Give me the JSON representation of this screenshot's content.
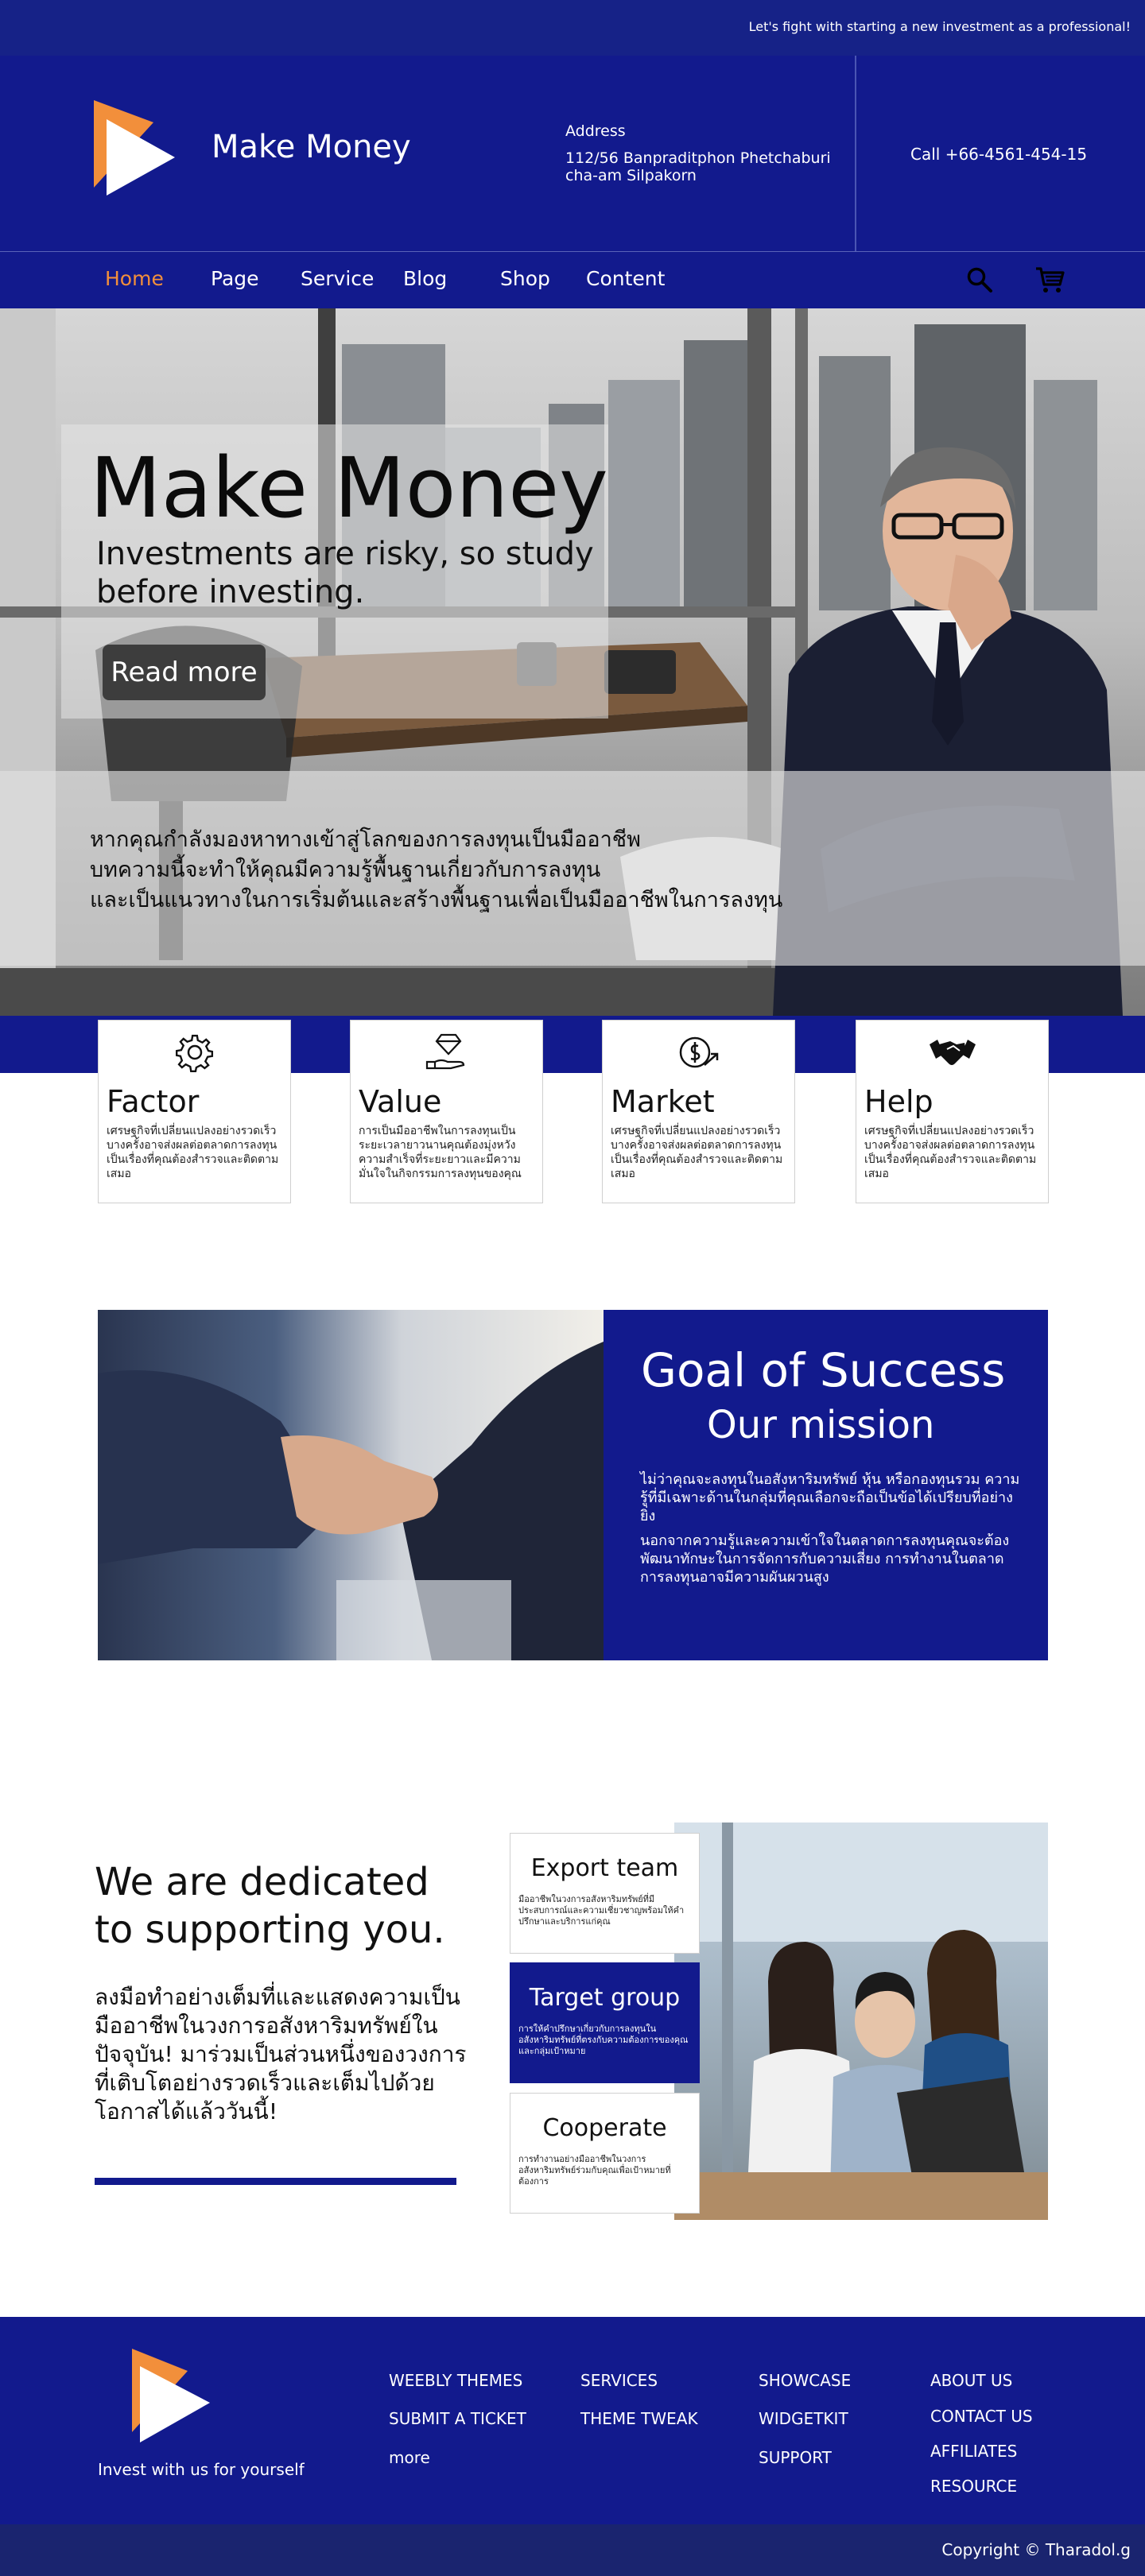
{
  "topbar": {
    "tagline": "Let's fight with starting a new investment as a professional!"
  },
  "header": {
    "brand": "Make Money",
    "address_title": "Address",
    "address_line1": "112/56 Banpraditphon Phetchaburi",
    "address_line2": "cha-am  Silpakorn",
    "call": "Call +66-4561-454-15"
  },
  "nav": {
    "items": [
      "Home",
      "Page",
      "Service",
      "Blog",
      "Shop",
      "Content"
    ],
    "active": "Home",
    "icons": [
      "search-icon",
      "cart-icon"
    ]
  },
  "hero": {
    "title": "Make Money",
    "subtitle": "Investments are risky, so study before investing.",
    "button": "Read more",
    "description_lines": [
      "หากคุณกำลังมองหาทางเข้าสู่โลกของการลงทุนเป็นมืออาชีพ",
      "บทความนี้จะทำให้คุณมีความรู้พื้นฐานเกี่ยวกับการลงทุน",
      "และเป็นแนวทางในการเริ่มต้นและสร้างพื้นฐานเพื่อเป็นมืออาชีพในการลงทุน"
    ]
  },
  "features": [
    {
      "icon": "gear-icon",
      "title": "Factor",
      "desc": "เศรษฐกิจที่เปลี่ยนแปลงอย่างรวดเร็วบางครั้งอาจส่งผลต่อตลาดการลงทุนเป็นเรื่องที่คุณต้องสำรวจและติดตามเสมอ"
    },
    {
      "icon": "diamond-hand-icon",
      "title": "Value",
      "desc": "การเป็นมืออาชีพในการลงทุนเป็นระยะเวลายาวนานคุณต้องมุ่งหวังความสำเร็จที่ระยะยาวและมีความมั่นใจในกิจกรรมการลงทุนของคุณ"
    },
    {
      "icon": "money-growth-icon",
      "title": "Market",
      "desc": "เศรษฐกิจที่เปลี่ยนแปลงอย่างรวดเร็วบางครั้งอาจส่งผลต่อตลาดการลงทุนเป็นเรื่องที่คุณต้องสำรวจและติดตามเสมอ"
    },
    {
      "icon": "handshake-icon",
      "title": "Help",
      "desc": "เศรษฐกิจที่เปลี่ยนแปลงอย่างรวดเร็วบางครั้งอาจส่งผลต่อตลาดการลงทุนเป็นเรื่องที่คุณต้องสำรวจและติดตามเสมอ"
    }
  ],
  "goal": {
    "title": "Goal of Success",
    "subtitle": "Our mission",
    "para1": "ไม่ว่าคุณจะลงทุนในอสังหาริมทรัพย์ หุ้น หรือกองทุนรวม ความรู้ที่มีเฉพาะด้านในกลุ่มที่คุณเลือกจะถือเป็นข้อได้เปรียบที่อย่างยิ่ง",
    "para2": "นอกจากความรู้และความเข้าใจในตลาดการลงทุนคุณจะต้องพัฒนาทักษะในการจัดการกับความเสี่ยง การทำงานในตลาดการลงทุนอาจมีความผันผวนสูง"
  },
  "dedicated": {
    "title_line1": "We are dedicated",
    "title_line2": "to supporting you.",
    "text": "ลงมือทำอย่างเต็มที่และแสดงความเป็นมืออาชีพในวงการอสังหาริมทรัพย์ในปัจจุบัน! มาร่วมเป็นส่วนหนึ่งของวงการที่เติบโตอย่างรวดเร็วและเต็มไปด้วยโอกาสได้แล้ววันนี้!",
    "cards": [
      {
        "title": "Export team",
        "desc": "มืออาชีพในวงการอสังหาริมทรัพย์ที่มีประสบการณ์และความเชี่ยวชาญพร้อมให้คำปรึกษาและบริการแก่คุณ"
      },
      {
        "title": "Target group",
        "desc": "การให้คำปรึกษาเกี่ยวกับการลงทุนในอสังหาริมทรัพย์ที่ตรงกับความต้องการของคุณและกลุ่มเป้าหมาย"
      },
      {
        "title": "Cooperate",
        "desc": "การทำงานอย่างมืออาชีพในวงการอสังหาริมทรัพย์ร่วมกับคุณเพื่อเป้าหมายที่ต้องการ"
      }
    ]
  },
  "footer": {
    "tagline": "Invest with us for yourself",
    "col1": [
      "WEEBLY THEMES",
      "SUBMIT A TICKET",
      "more"
    ],
    "col2": [
      "SERVICES",
      "THEME TWEAK"
    ],
    "col3": [
      "SHOWCASE",
      "WIDGETKIT",
      "SUPPORT"
    ],
    "col4": [
      "ABOUT US",
      "CONTACT US",
      "AFFILIATES",
      "RESOURCE"
    ],
    "copyright": "Copyright © Tharadol.g"
  },
  "colors": {
    "brand_navy": "#121a8d",
    "accent_orange": "#f28f3b"
  }
}
